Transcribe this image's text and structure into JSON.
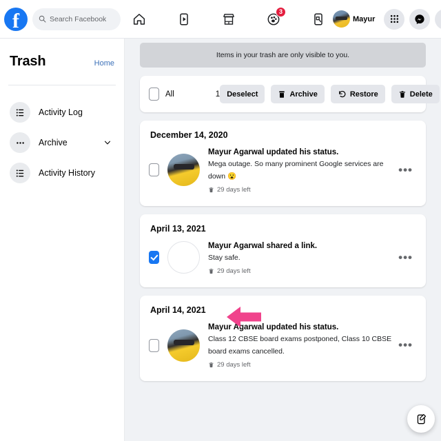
{
  "topnav": {
    "logo": "facebook-logo",
    "search": {
      "placeholder": "Search Facebook",
      "value": ""
    },
    "tabs": [
      {
        "name": "home-tab",
        "icon": "home-icon",
        "badge": ""
      },
      {
        "name": "watch-tab",
        "icon": "video-play-icon",
        "badge": ""
      },
      {
        "name": "marketplace-tab",
        "icon": "storefront-icon",
        "badge": ""
      },
      {
        "name": "groups-tab",
        "icon": "groups-icon",
        "badge": "3"
      },
      {
        "name": "gaming-tab",
        "icon": "gaming-icon",
        "badge": ""
      }
    ],
    "profile_name": "Mayur",
    "right_buttons": [
      {
        "name": "menu-grid-button",
        "icon": "grid-icon"
      },
      {
        "name": "messenger-button",
        "icon": "messenger-icon"
      },
      {
        "name": "notifications-button",
        "icon": "bell-icon"
      },
      {
        "name": "account-dropdown-button",
        "icon": "chevron-down-icon"
      }
    ]
  },
  "sidebar": {
    "title": "Trash",
    "home_link": "Home",
    "items": [
      {
        "label": "Activity Log",
        "icon": "list-icon",
        "chevron": false
      },
      {
        "label": "Archive",
        "icon": "dots-icon",
        "chevron": true
      },
      {
        "label": "Activity History",
        "icon": "list-icon",
        "chevron": false
      }
    ]
  },
  "main": {
    "notice": "Items in your trash are only visible to you.",
    "toolbar": {
      "all_label": "All",
      "selected_count": "1",
      "buttons": [
        {
          "label": "Deselect",
          "icon": ""
        },
        {
          "label": "Archive",
          "icon": "archive-icon"
        },
        {
          "label": "Restore",
          "icon": "restore-icon"
        },
        {
          "label": "Delete",
          "icon": "trash-icon"
        }
      ]
    },
    "groups": [
      {
        "date": "December 14, 2020",
        "checked": false,
        "avatar": "photo",
        "title": "Mayur Agarwal updated his status.",
        "text": "Mega outage. So many prominent Google services are down 😮",
        "expiry": "29 days left"
      },
      {
        "date": "April 13, 2021",
        "checked": true,
        "avatar": "empty",
        "title": "Mayur Agarwal shared a link.",
        "text": "Stay safe.",
        "expiry": "29 days left"
      },
      {
        "date": "April 14, 2021",
        "checked": false,
        "avatar": "photo",
        "title": "Mayur Agarwal updated his status.",
        "text": "Class 12 CBSE board exams postponed, Class 10 CBSE board exams cancelled.",
        "expiry": "29 days left"
      }
    ]
  },
  "fab": {
    "icon": "compose-icon"
  },
  "annotation": {
    "type": "arrow-left",
    "color": "#F0438C"
  },
  "colors": {
    "brand_blue": "#1877F2",
    "page_bg": "#F0F2F5",
    "card_bg": "#FFFFFF",
    "notice_bg": "#D2D4D8",
    "badge_red": "#E41E3F",
    "link_blue": "#3B70B8",
    "annotation_pink": "#F0438C"
  }
}
